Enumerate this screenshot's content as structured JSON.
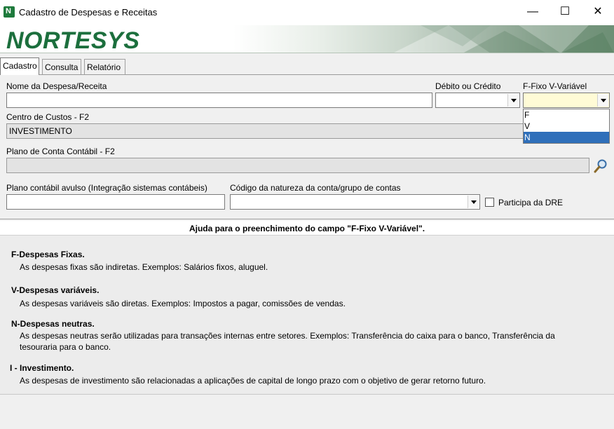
{
  "window": {
    "title": "Cadastro de Despesas e Receitas",
    "minimize_glyph": "—",
    "maximize_glyph": "☐",
    "close_glyph": "✕"
  },
  "banner": {
    "logo_text": "NORTESYS"
  },
  "tabs": [
    {
      "label": "Cadastro",
      "active": true
    },
    {
      "label": "Consulta",
      "active": false
    },
    {
      "label": "Relatório",
      "active": false
    }
  ],
  "form": {
    "nome": {
      "label": "Nome da Despesa/Receita",
      "value": ""
    },
    "debito_credito": {
      "label": "Débito ou Crédito",
      "value": ""
    },
    "fixo_variavel": {
      "label": "F-Fixo V-Variável",
      "value": "",
      "options": [
        "F",
        "V",
        "N"
      ],
      "highlighted": "N"
    },
    "centro_custos": {
      "label": "Centro de Custos - F2",
      "value": "INVESTIMENTO"
    },
    "plano_conta": {
      "label": "Plano de Conta Contábil - F2",
      "value": ""
    },
    "plano_avulso": {
      "label": "Plano contábil avulso (Integração sistemas contábeis)",
      "value": ""
    },
    "codigo_natureza": {
      "label": "Código da natureza da conta/grupo de contas",
      "value": ""
    },
    "participa_dre": {
      "label": "Participa da DRE",
      "checked": false
    }
  },
  "help": {
    "header": "Ajuda para o preenchimento do campo \"F-Fixo V-Variável\".",
    "sections": [
      {
        "title": "F-Despesas Fixas.",
        "text": "As despesas fixas são indiretas. Exemplos: Salários fixos, aluguel."
      },
      {
        "title": "V-Despesas variáveis.",
        "text": "As despesas variáveis são diretas. Exemplos: Impostos a pagar, comissões de vendas."
      },
      {
        "title": "N-Despesas neutras.",
        "text": "As despesas neutras serão utilizadas para transações internas entre setores. Exemplos: Transferência do caixa para o banco, Transferência da tesouraria para o banco."
      },
      {
        "title": "I - Investimento.",
        "text": "As despesas de investimento são relacionadas a aplicações de capital de longo prazo com o objetivo de gerar retorno futuro."
      }
    ]
  },
  "colors": {
    "brand": "#1c6f3d",
    "selection": "#2f6fba"
  },
  "icons": [
    "app-icon",
    "search-icon",
    "chevron-down-icon"
  ]
}
